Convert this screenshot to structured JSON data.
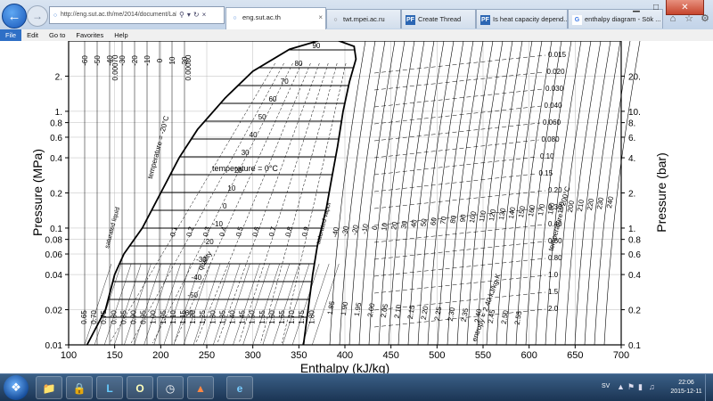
{
  "browser": {
    "address": "http://eng.sut.ac.th/me/2014/document/LabMechani",
    "tabs": [
      {
        "label": "eng.sut.ac.th",
        "favicon": "page-icon"
      },
      {
        "label": "twt.mpei.ac.ru",
        "favicon": "page-icon"
      },
      {
        "label": "Create Thread",
        "favicon": "pf-icon"
      },
      {
        "label": "Is heat capacity depend...",
        "favicon": "pf-icon"
      },
      {
        "label": "enthalpy diagram - Sök ...",
        "favicon": "google-icon"
      }
    ],
    "menu": [
      "File",
      "Edit",
      "Go to",
      "Favorites",
      "Help"
    ],
    "window_controls": {
      "minimize": "▁",
      "maximize": "□",
      "close": "✕"
    }
  },
  "chart_data": {
    "type": "line",
    "xlabel": "Enthalpy (kJ/kg)",
    "ylabel_left": "Pressure (MPa)",
    "ylabel_right": "Pressure (bar)",
    "x_ticks": [
      100,
      150,
      200,
      250,
      300,
      350,
      400,
      450,
      500,
      550,
      600,
      650,
      700
    ],
    "x_range": [
      100,
      700
    ],
    "y_scale": "log",
    "y_range": [
      0.01,
      4
    ],
    "y_ticks_left": [
      "2.",
      "1.",
      "0.8",
      "0.6",
      "0.4",
      "0.2",
      "0.1",
      "0.08",
      "0.06",
      "0.04",
      "0.02",
      "0.01"
    ],
    "y_values_left": [
      2,
      1,
      0.8,
      0.6,
      0.4,
      0.2,
      0.1,
      0.08,
      0.06,
      0.04,
      0.02,
      0.01
    ],
    "y_ticks_right": [
      "20.",
      "10.",
      "8.",
      "6.",
      "4.",
      "2.",
      "1.",
      "0.8",
      "0.6",
      "0.4",
      "0.2",
      "0.1"
    ],
    "y_values_right": [
      2,
      1,
      0.8,
      0.6,
      0.4,
      0.2,
      0.1,
      0.08,
      0.06,
      0.04,
      0.02,
      0.01
    ],
    "saturation_dome": {
      "liquid": [
        [
          120,
          0.01
        ],
        [
          140,
          0.02
        ],
        [
          150,
          0.04
        ],
        [
          160,
          0.06
        ],
        [
          180,
          0.1
        ],
        [
          200,
          0.2
        ],
        [
          220,
          0.4
        ],
        [
          240,
          0.7
        ],
        [
          270,
          1.3
        ],
        [
          300,
          2.2
        ],
        [
          340,
          3.4
        ],
        [
          375,
          4.1
        ]
      ],
      "vapor": [
        [
          355,
          0.01
        ],
        [
          360,
          0.02
        ],
        [
          365,
          0.04
        ],
        [
          370,
          0.07
        ],
        [
          380,
          0.15
        ],
        [
          385,
          0.25
        ],
        [
          392,
          0.5
        ],
        [
          398,
          1
        ],
        [
          405,
          1.8
        ],
        [
          412,
          2.8
        ],
        [
          410,
          3.6
        ],
        [
          390,
          4.1
        ]
      ]
    },
    "quality_labels": [
      "0.1",
      "0.2",
      "0.3",
      "0.4",
      "0.5",
      "0.6",
      "0.7",
      "0.8",
      "0.9"
    ],
    "isotherm_labels_in_dome": [
      "90",
      "80",
      "70",
      "60",
      "50",
      "40",
      "30",
      "20",
      "10",
      "0",
      "-10",
      "-20",
      "-30",
      "-40",
      "-50",
      "-60"
    ],
    "isotherm_top_labels": [
      "-60",
      "-50",
      "-40",
      "-30",
      "-20",
      "-10",
      "0",
      "10",
      "20"
    ],
    "density_top_labels": [
      "0.00070",
      "0.00080"
    ],
    "bottom_h_labels": [
      "0.65",
      "0.70",
      "0.75",
      "0.80",
      "0.85",
      "0.90",
      "0.95",
      "1.00",
      "1.05",
      "1.10",
      "1.15",
      "1.20",
      "1.25",
      "1.30",
      "1.35",
      "1.40",
      "1.45",
      "1.50",
      "1.55",
      "1.60",
      "1.65",
      "1.70",
      "1.75",
      "1.80"
    ],
    "vapor_h_labels": [
      "1.85",
      "1.90",
      "1.95",
      "2.00",
      "2.05",
      "2.10",
      "2.15",
      "2.20",
      "2.25",
      "2.30",
      "2.35",
      "2.40",
      "2.45",
      "2.50",
      "2.55"
    ],
    "superheat_isotherm_labels": [
      "-40",
      "-30",
      "-20",
      "-10",
      "0",
      "10",
      "20",
      "30",
      "40",
      "50",
      "60",
      "70",
      "80",
      "90",
      "100",
      "110",
      "120",
      "130",
      "140",
      "150",
      "160",
      "170",
      "180",
      "190",
      "200",
      "210",
      "220",
      "230",
      "240"
    ],
    "specific_volume_labels": [
      "0.015",
      "0.020",
      "0.030",
      "0.040",
      "0.060",
      "0.080",
      "0.10",
      "0.15",
      "0.20",
      "0.30",
      "0.40",
      "0.60",
      "0.80",
      "1.0",
      "1.5",
      "2.0"
    ],
    "annotations": [
      "temperature = -20°C",
      "temperature = 0°C",
      "temperature = 200°C",
      "saturated liquid",
      "saturated vapor",
      "quality",
      "entropy = 2.40 kJ/kg·K"
    ]
  },
  "taskbar": {
    "apps": [
      {
        "name": "explorer",
        "icon": "folder-icon"
      },
      {
        "name": "security",
        "icon": "lock-icon"
      },
      {
        "name": "lync",
        "icon": "lync-icon"
      },
      {
        "name": "outlook",
        "icon": "outlook-icon"
      },
      {
        "name": "clock",
        "icon": "clock-icon"
      },
      {
        "name": "matlab",
        "icon": "matlab-icon"
      },
      {
        "name": "internet explorer",
        "icon": "ie-icon"
      }
    ],
    "language": "SV",
    "time": "22:06",
    "date": "2015-12-11"
  }
}
